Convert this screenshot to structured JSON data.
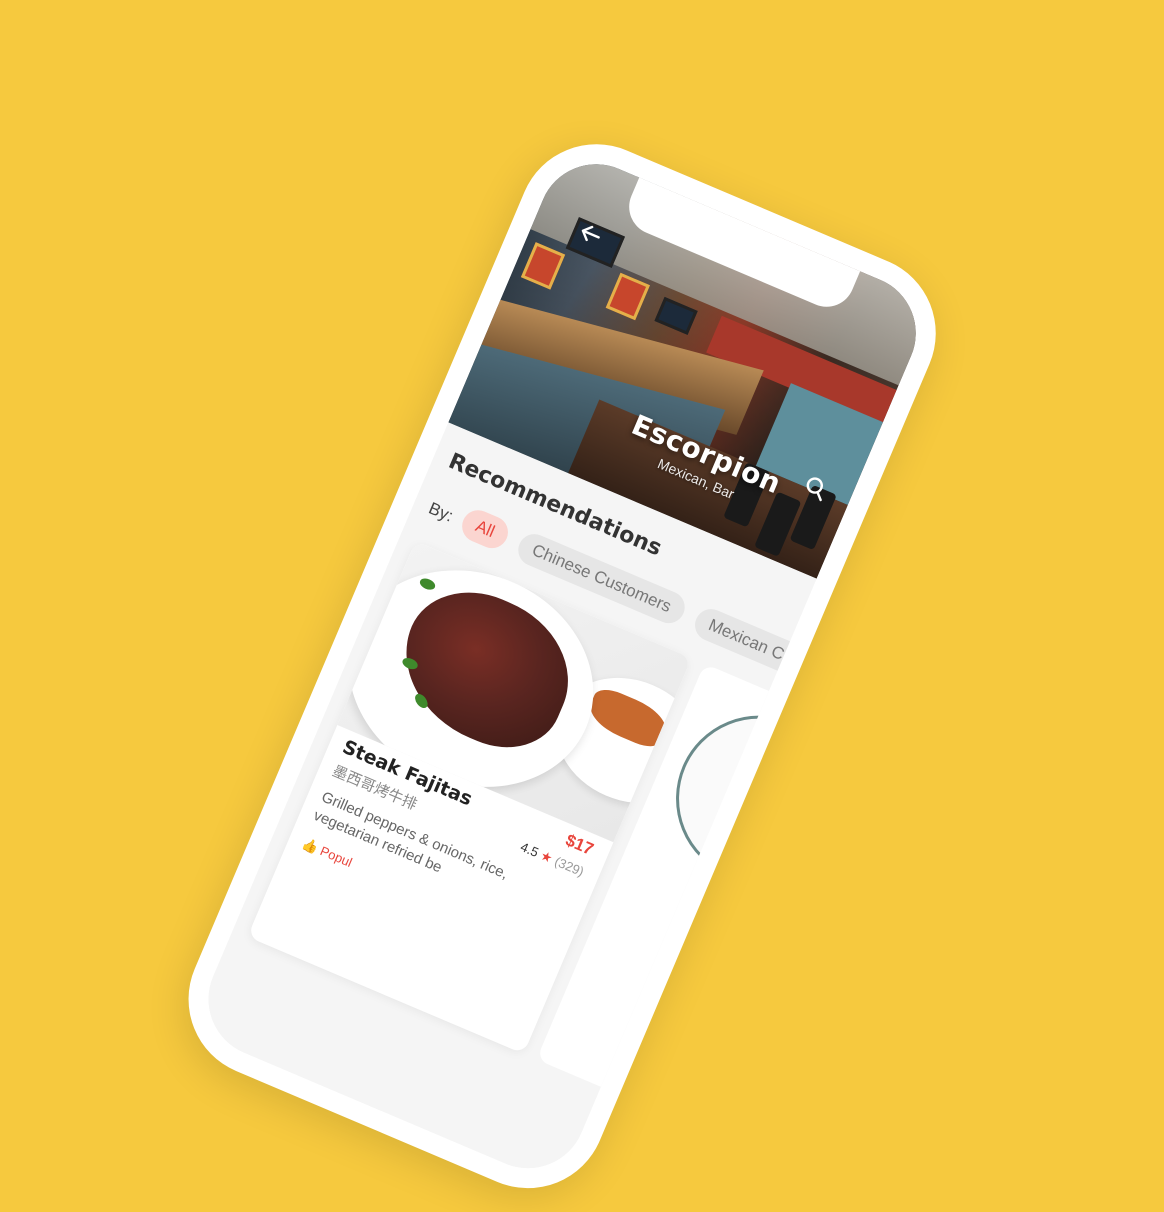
{
  "restaurant": {
    "name": "Escorpion",
    "cuisine": "Mexican, Bar"
  },
  "recommendations": {
    "title": "Recommendations",
    "by_label": "By:",
    "filters": [
      {
        "label": "All",
        "active": true
      },
      {
        "label": "Chinese Customers",
        "active": false
      },
      {
        "label": "Mexican Custon",
        "active": false
      }
    ]
  },
  "dish": {
    "name": "Steak Fajitas",
    "name_cn": "墨西哥烤牛排",
    "description": "Grilled peppers & onions, rice, vegetarian refried be",
    "price": "$17",
    "rating": "4.5",
    "rating_count": "(329)",
    "badge": "Popul"
  },
  "icons": {
    "back": "arrow-left-icon",
    "search": "search-icon",
    "star": "star-icon",
    "thumb": "thumbs-up-icon"
  },
  "colors": {
    "background": "#F6C93E",
    "accent": "#E8453C",
    "chip_active_bg": "#FBD5D0",
    "chip_bg": "#E6E6E6"
  }
}
